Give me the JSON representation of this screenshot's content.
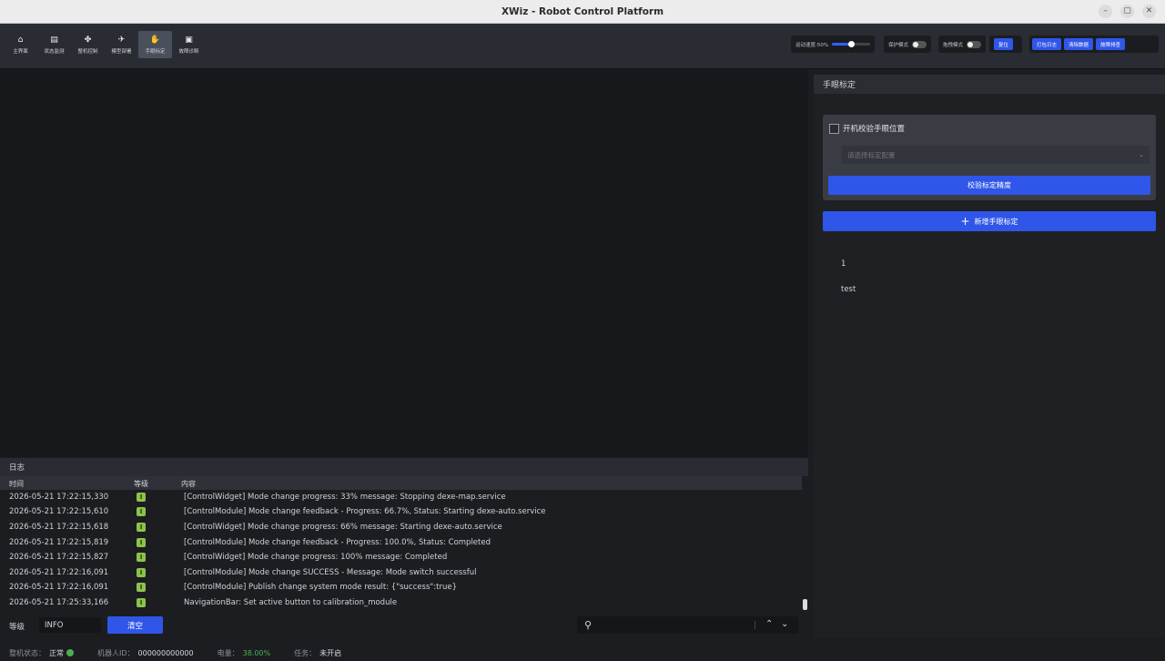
{
  "window": {
    "title": "XWiz - Robot Control Platform",
    "controls": [
      "–",
      "▢",
      "✕"
    ]
  },
  "nav": {
    "items": [
      {
        "label": "主界面",
        "icon": "home-icon",
        "glyph": "⌂"
      },
      {
        "label": "状态监测",
        "icon": "monitor-icon",
        "glyph": "▤"
      },
      {
        "label": "整机控制",
        "icon": "control-icon",
        "glyph": "✤"
      },
      {
        "label": "模型部署",
        "icon": "rocket-icon",
        "glyph": "✈"
      },
      {
        "label": "手眼标定",
        "icon": "hand-icon",
        "glyph": "✋"
      },
      {
        "label": "故障诊断",
        "icon": "diagnosis-icon",
        "glyph": "▣"
      }
    ],
    "active_index": 4
  },
  "toolbar": {
    "speed_label": "运动速度:50%",
    "speed_fraction": 0.5,
    "protect_label": "保护模式",
    "drag_label": "拖拽模式",
    "reset_label": "复位",
    "pack_log_label": "打包日志",
    "clear_data_label": "清除数据",
    "fault_clear_label": "故障排查"
  },
  "calibration": {
    "panel_title": "手眼标定",
    "startup_check_label": "开机校验手眼位置",
    "startup_check_checked": false,
    "select_placeholder": "请选择标定配置",
    "verify_button": "校验标定精度",
    "add_button": "新增手眼标定",
    "items": [
      "1",
      "test"
    ]
  },
  "log": {
    "title": "日志",
    "columns": {
      "time": "时间",
      "level": "等级",
      "content": "内容"
    },
    "rows": [
      {
        "time": "2026-05-21 17:22:15,330",
        "level": "I",
        "message": "[ControlWidget] Mode change progress: 33% message: Stopping dexe-map.service"
      },
      {
        "time": "2026-05-21 17:22:15,610",
        "level": "I",
        "message": "[ControlModule] Mode change feedback - Progress: 66.7%, Status: Starting dexe-auto.service"
      },
      {
        "time": "2026-05-21 17:22:15,618",
        "level": "I",
        "message": "[ControlWidget] Mode change progress: 66% message: Starting dexe-auto.service"
      },
      {
        "time": "2026-05-21 17:22:15,819",
        "level": "I",
        "message": "[ControlModule] Mode change feedback - Progress: 100.0%, Status: Completed"
      },
      {
        "time": "2026-05-21 17:22:15,827",
        "level": "I",
        "message": "[ControlWidget] Mode change progress: 100% message: Completed"
      },
      {
        "time": "2026-05-21 17:22:16,091",
        "level": "I",
        "message": "[ControlModule] Mode change SUCCESS - Message: Mode switch successful"
      },
      {
        "time": "2026-05-21 17:22:16,091",
        "level": "I",
        "message": "[ControlModule] Publish change system mode result: {\"success\":true}"
      },
      {
        "time": "2026-05-21 17:25:33,166",
        "level": "I",
        "message": "NavigationBar: Set active button to calibration_module"
      }
    ],
    "filter_label": "等级",
    "filter_value": "INFO",
    "clear_button": "清空",
    "search_value": ""
  },
  "status": {
    "machine_state_label": "整机状态：",
    "machine_state_value": "正常",
    "robot_id_label": "机器人ID：",
    "robot_id_value": "000000000000",
    "battery_label": "电量：",
    "battery_value": "38.00%",
    "task_label": "任务：",
    "task_value": "未开启"
  },
  "colors": {
    "accent": "#2f56e8",
    "ok": "#4caf50",
    "level_info": "#8bc34a"
  }
}
